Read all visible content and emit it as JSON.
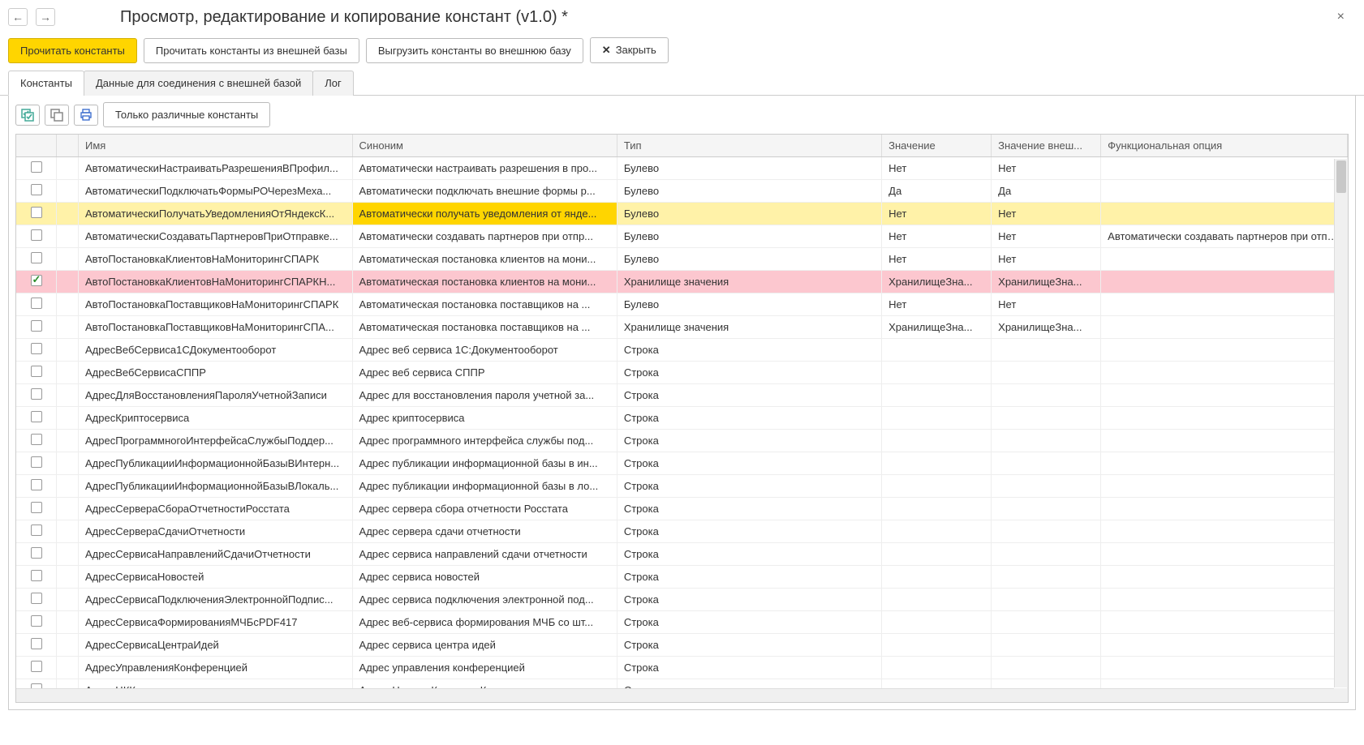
{
  "header": {
    "back_icon": "←",
    "forward_icon": "→",
    "title": "Просмотр, редактирование и копирование констант (v1.0) *",
    "close_icon": "×"
  },
  "toolbar": {
    "read_constants": "Прочитать константы",
    "read_external": "Прочитать константы из внешней базы",
    "export_external": "Выгрузить константы во внешнюю базу",
    "close_label": "Закрыть",
    "close_x": "✕"
  },
  "tabs": [
    {
      "label": "Константы",
      "active": true
    },
    {
      "label": "Данные для соединения с внешней базой",
      "active": false
    },
    {
      "label": "Лог",
      "active": false
    }
  ],
  "inner_toolbar": {
    "only_different": "Только различные константы"
  },
  "columns": {
    "name": "Имя",
    "synonym": "Синоним",
    "type": "Тип",
    "value": "Значение",
    "ext_value": "Значение внеш...",
    "func_option": "Функциональная опция"
  },
  "rows": [
    {
      "checked": false,
      "name": "АвтоматическиНастраиватьРазрешенияВПрофил...",
      "synonym": "Автоматически настраивать разрешения в про...",
      "type": "Булево",
      "value": "Нет",
      "ext_value": "Нет",
      "func": "",
      "highlight": ""
    },
    {
      "checked": false,
      "name": "АвтоматическиПодключатьФормыРОЧерезМеха...",
      "synonym": "Автоматически подключать внешние формы р...",
      "type": "Булево",
      "value": "Да",
      "ext_value": "Да",
      "func": "",
      "highlight": ""
    },
    {
      "checked": false,
      "name": "АвтоматическиПолучатьУведомленияОтЯндексК...",
      "synonym": "Автоматически получать уведомления от янде...",
      "type": "Булево",
      "value": "Нет",
      "ext_value": "Нет",
      "func": "",
      "highlight": "yellow"
    },
    {
      "checked": false,
      "name": "АвтоматическиСоздаватьПартнеровПриОтправке...",
      "synonym": "Автоматически создавать партнеров при отпр...",
      "type": "Булево",
      "value": "Нет",
      "ext_value": "Нет",
      "func": "Автоматически создавать партнеров при отпра...",
      "highlight": ""
    },
    {
      "checked": false,
      "name": "АвтоПостановкаКлиентовНаМониторингСПАРК",
      "synonym": "Автоматическая постановка клиентов на мони...",
      "type": "Булево",
      "value": "Нет",
      "ext_value": "Нет",
      "func": "",
      "highlight": ""
    },
    {
      "checked": true,
      "name": "АвтоПостановкаКлиентовНаМониторингСПАРКН...",
      "synonym": "Автоматическая постановка клиентов на мони...",
      "type": "Хранилище значения",
      "value": "ХранилищеЗна...",
      "ext_value": "ХранилищеЗна...",
      "func": "",
      "highlight": "pink"
    },
    {
      "checked": false,
      "name": "АвтоПостановкаПоставщиковНаМониторингСПАРК",
      "synonym": "Автоматическая постановка поставщиков на ...",
      "type": "Булево",
      "value": "Нет",
      "ext_value": "Нет",
      "func": "",
      "highlight": ""
    },
    {
      "checked": false,
      "name": "АвтоПостановкаПоставщиковНаМониторингСПА...",
      "synonym": "Автоматическая постановка поставщиков на ...",
      "type": "Хранилище значения",
      "value": "ХранилищеЗна...",
      "ext_value": "ХранилищеЗна...",
      "func": "",
      "highlight": ""
    },
    {
      "checked": false,
      "name": "АдресВебСервиса1СДокументооборот",
      "synonym": "Адрес веб сервиса 1С:Документооборот",
      "type": "Строка",
      "value": "",
      "ext_value": "",
      "func": "",
      "highlight": ""
    },
    {
      "checked": false,
      "name": "АдресВебСервисаСППР",
      "synonym": "Адрес веб сервиса СППР",
      "type": "Строка",
      "value": "",
      "ext_value": "",
      "func": "",
      "highlight": ""
    },
    {
      "checked": false,
      "name": "АдресДляВосстановленияПароляУчетнойЗаписи",
      "synonym": "Адрес для восстановления пароля учетной за...",
      "type": "Строка",
      "value": "",
      "ext_value": "",
      "func": "",
      "highlight": ""
    },
    {
      "checked": false,
      "name": "АдресКриптосервиса",
      "synonym": "Адрес криптосервиса",
      "type": "Строка",
      "value": "",
      "ext_value": "",
      "func": "",
      "highlight": ""
    },
    {
      "checked": false,
      "name": "АдресПрограммногоИнтерфейсаСлужбыПоддер...",
      "synonym": "Адрес программного интерфейса службы под...",
      "type": "Строка",
      "value": "",
      "ext_value": "",
      "func": "",
      "highlight": ""
    },
    {
      "checked": false,
      "name": "АдресПубликацииИнформационнойБазыВИнтерн...",
      "synonym": "Адрес публикации информационной базы в ин...",
      "type": "Строка",
      "value": "",
      "ext_value": "",
      "func": "",
      "highlight": ""
    },
    {
      "checked": false,
      "name": "АдресПубликацииИнформационнойБазыВЛокаль...",
      "synonym": "Адрес публикации информационной базы в ло...",
      "type": "Строка",
      "value": "",
      "ext_value": "",
      "func": "",
      "highlight": ""
    },
    {
      "checked": false,
      "name": "АдресСервераСбораОтчетностиРосстата",
      "synonym": "Адрес сервера сбора отчетности Росстата",
      "type": "Строка",
      "value": "",
      "ext_value": "",
      "func": "",
      "highlight": ""
    },
    {
      "checked": false,
      "name": "АдресСервераСдачиОтчетности",
      "synonym": "Адрес сервера сдачи отчетности",
      "type": "Строка",
      "value": "",
      "ext_value": "",
      "func": "",
      "highlight": ""
    },
    {
      "checked": false,
      "name": "АдресСервисаНаправленийСдачиОтчетности",
      "synonym": "Адрес сервиса направлений сдачи отчетности",
      "type": "Строка",
      "value": "",
      "ext_value": "",
      "func": "",
      "highlight": ""
    },
    {
      "checked": false,
      "name": "АдресСервисаНовостей",
      "synonym": "Адрес сервиса новостей",
      "type": "Строка",
      "value": "",
      "ext_value": "",
      "func": "",
      "highlight": ""
    },
    {
      "checked": false,
      "name": "АдресСервисаПодключенияЭлектроннойПодпис...",
      "synonym": "Адрес сервиса подключения электронной под...",
      "type": "Строка",
      "value": "",
      "ext_value": "",
      "func": "",
      "highlight": ""
    },
    {
      "checked": false,
      "name": "АдресСервисаФормированияМЧБсPDF417",
      "synonym": "Адрес веб-сервиса формирования МЧБ со шт...",
      "type": "Строка",
      "value": "",
      "ext_value": "",
      "func": "",
      "highlight": ""
    },
    {
      "checked": false,
      "name": "АдресСервисаЦентраИдей",
      "synonym": "Адрес сервиса центра идей",
      "type": "Строка",
      "value": "",
      "ext_value": "",
      "func": "",
      "highlight": ""
    },
    {
      "checked": false,
      "name": "АдресУправленияКонференцией",
      "synonym": "Адрес управления конференцией",
      "type": "Строка",
      "value": "",
      "ext_value": "",
      "func": "",
      "highlight": ""
    },
    {
      "checked": false,
      "name": "АдресЦКК",
      "synonym": "Адрес Центра Контроля Качества",
      "type": "Строка",
      "value": "",
      "ext_value": "",
      "func": "",
      "highlight": ""
    }
  ]
}
